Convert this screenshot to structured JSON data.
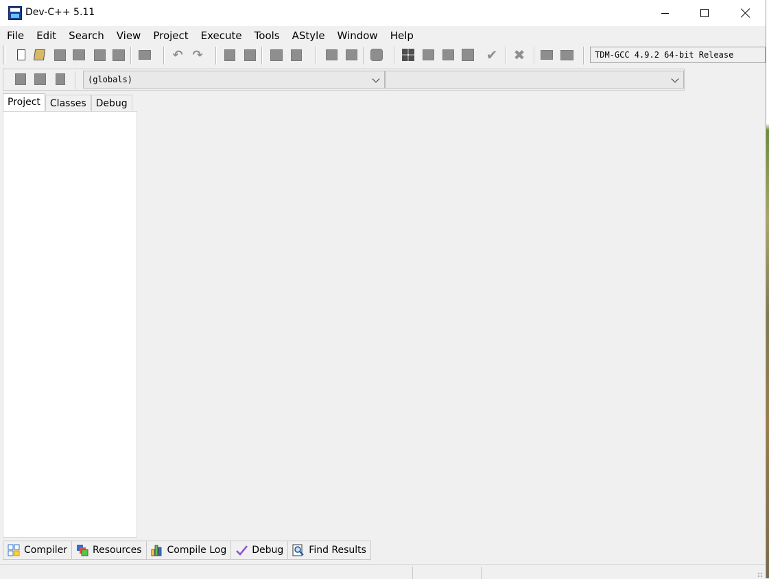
{
  "window": {
    "title": "Dev-C++ 5.11"
  },
  "menu": [
    "File",
    "Edit",
    "Search",
    "View",
    "Project",
    "Execute",
    "Tools",
    "AStyle",
    "Window",
    "Help"
  ],
  "toolbar": {
    "compiler": "TDM-GCC 4.9.2 64-bit Release"
  },
  "class_bar": {
    "scope_value": "(globals)",
    "member_value": ""
  },
  "left_tabs": [
    "Project",
    "Classes",
    "Debug"
  ],
  "bottom_tabs": [
    "Compiler",
    "Resources",
    "Compile Log",
    "Debug",
    "Find Results"
  ]
}
